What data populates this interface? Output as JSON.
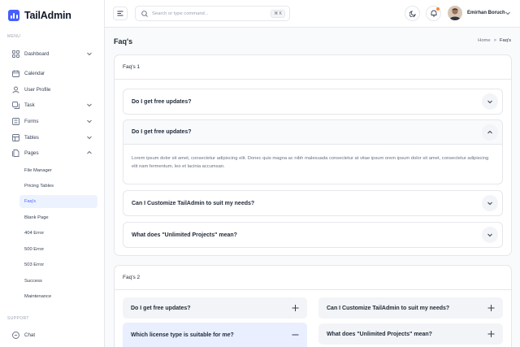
{
  "brand": {
    "name": "TailAdmin"
  },
  "sidebar": {
    "menu_heading": "MENU",
    "support_heading": "SUPPORT",
    "items": [
      {
        "label": "Dashboard",
        "icon": "grid-icon"
      },
      {
        "label": "Calendar",
        "icon": "calendar-icon"
      },
      {
        "label": "User Profile",
        "icon": "user-icon"
      },
      {
        "label": "Task",
        "icon": "task-icon"
      },
      {
        "label": "Forms",
        "icon": "forms-icon"
      },
      {
        "label": "Tables",
        "icon": "table-icon"
      },
      {
        "label": "Pages",
        "icon": "pages-icon"
      }
    ],
    "subitems": [
      "File Manager",
      "Pricing Tables",
      "Faq's",
      "Blank Page",
      "404 Error",
      "500 Error",
      "503 Error",
      "Success",
      "Maintenance"
    ],
    "active_subitem": "Faq's",
    "support_items": [
      {
        "label": "Chat",
        "icon": "chat-icon"
      }
    ]
  },
  "header": {
    "search_placeholder": "Search or type command...",
    "search_shortcut": "⌘ K",
    "user_name": "Emirhan Boruch"
  },
  "page": {
    "title": "Faq's",
    "breadcrumb": {
      "home": "Home",
      "separator": ">",
      "current": "Faq's"
    }
  },
  "faq1": {
    "title": "Faq's 1",
    "items": [
      {
        "question": "Do I get free updates?",
        "open": false
      },
      {
        "question": "Do I get free updates?",
        "open": true,
        "answer": "Lorem ipsum dolor sit amet, consectetur adipiscing elit. Donec quis magna ac nibh malesuada consectetur at vitae ipsum orem ipsum dolor sit amet, consectetur adipiscing elit nam fermentum, leo et lacinia accumsan."
      },
      {
        "question": "Can I Customize TailAdmin to suit my needs?",
        "open": false
      },
      {
        "question": "What does \"Unlimited Projects\" mean?",
        "open": false
      }
    ]
  },
  "faq2": {
    "title": "Faq's 2",
    "left": [
      {
        "question": "Do I get free updates?",
        "open": false
      },
      {
        "question": "Which license type is suitable for me?",
        "open": true
      }
    ],
    "right": [
      {
        "question": "Can I Customize TailAdmin to suit my needs?",
        "open": false
      },
      {
        "question": "What does \"Unlimited Projects\" mean?",
        "open": false
      }
    ]
  },
  "colors": {
    "accent": "#465fff",
    "active_bg": "#ecf3ff",
    "notification": "#fd853a"
  }
}
